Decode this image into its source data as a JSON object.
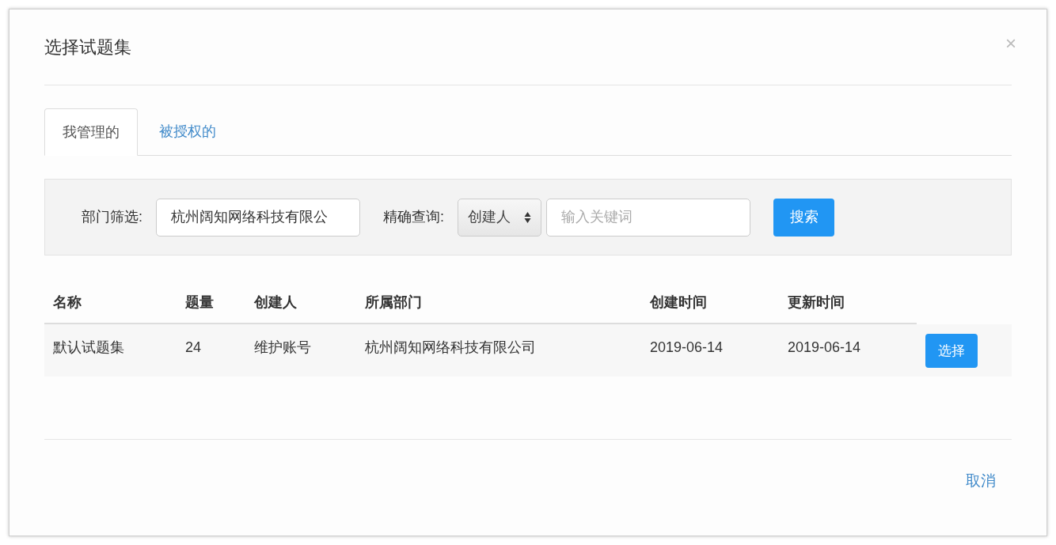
{
  "dialog": {
    "title": "选择试题集",
    "close": "×"
  },
  "tabs": [
    {
      "label": "我管理的",
      "selected": true
    },
    {
      "label": "被授权的",
      "selected": false
    }
  ],
  "filters": {
    "department_label": "部门筛选:",
    "department_value": "杭州阔知网络科技有限公",
    "query_label": "精确查询:",
    "query_field": "创建人",
    "keyword_placeholder": "输入关键词",
    "search_button": "搜索"
  },
  "table": {
    "columns": [
      "名称",
      "题量",
      "创建人",
      "所属部门",
      "创建时间",
      "更新时间"
    ],
    "rows": [
      {
        "cells": [
          "默认试题集",
          "24",
          "维护账号",
          "杭州阔知网络科技有限公司",
          "2019-06-14",
          "2019-06-14"
        ],
        "action": "选择"
      }
    ]
  },
  "footer": {
    "cancel": "取消"
  }
}
